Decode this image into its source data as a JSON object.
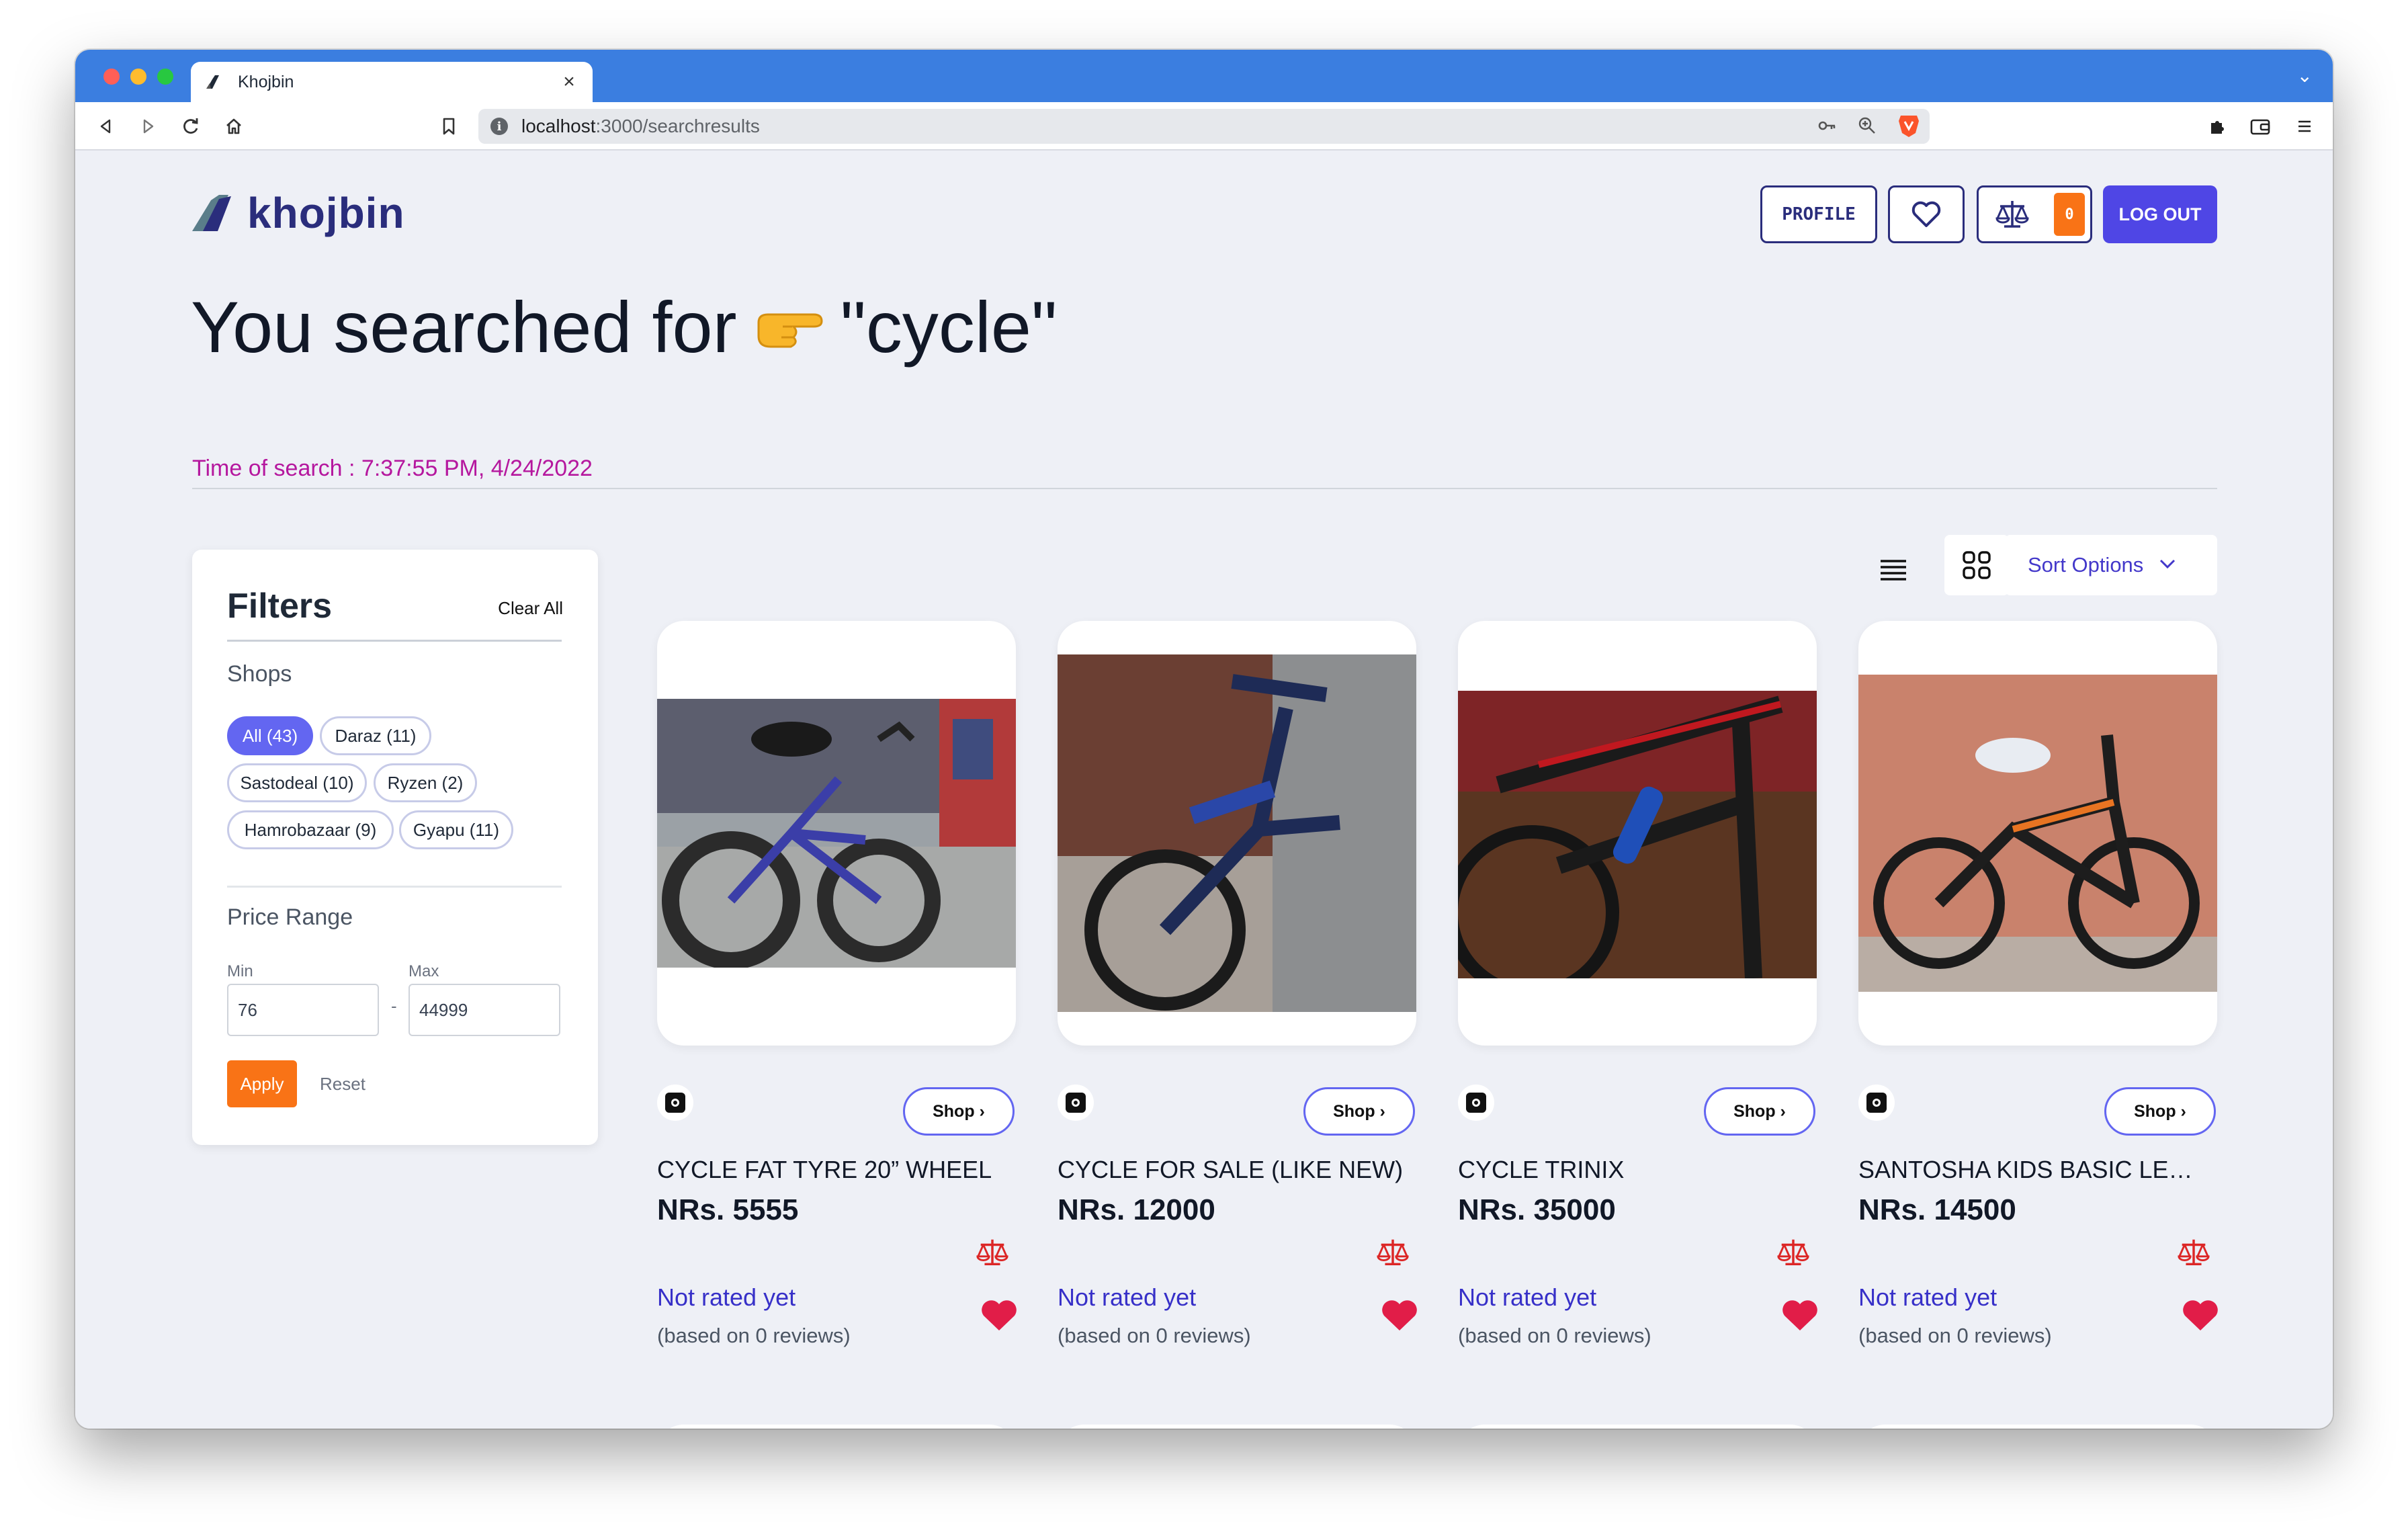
{
  "browser": {
    "tab_title": "Khojbin",
    "url_host": "localhost",
    "url_path": ":3000/searchresults"
  },
  "header": {
    "logo_text": "khojbin",
    "profile_label": "PROFILE",
    "compare_count": "0",
    "logout_label": "LOG OUT"
  },
  "search": {
    "prefix": "You searched for",
    "emoji": "👉",
    "query": "\"cycle\"",
    "time": "Time of search : 7:37:55 PM, 4/24/2022"
  },
  "filters": {
    "title": "Filters",
    "clear_all": "Clear All",
    "shops_label": "Shops",
    "shops": [
      {
        "label": "All (43)",
        "active": true
      },
      {
        "label": "Daraz (11)",
        "active": false
      },
      {
        "label": "Sastodeal (10)",
        "active": false
      },
      {
        "label": "Ryzen (2)",
        "active": false
      },
      {
        "label": "Hamrobazaar (9)",
        "active": false
      },
      {
        "label": "Gyapu (11)",
        "active": false
      }
    ],
    "price_label": "Price Range",
    "min_label": "Min",
    "max_label": "Max",
    "min_value": "76",
    "max_value": "44999",
    "dash": "-",
    "apply_label": "Apply",
    "reset_label": "Reset"
  },
  "sort": {
    "label": "Sort Options"
  },
  "products": [
    {
      "name": "CYCLE FAT TYRE 20” WHEEL",
      "price": "NRs. 5555",
      "shop_label": "Shop ›",
      "rating": "Not rated yet",
      "reviews": "(based on 0 reviews)"
    },
    {
      "name": "CYCLE FOR SALE (LIKE NEW)",
      "price": "NRs. 12000",
      "shop_label": "Shop ›",
      "rating": "Not rated yet",
      "reviews": "(based on 0 reviews)"
    },
    {
      "name": "CYCLE TRINIX",
      "price": "NRs. 35000",
      "shop_label": "Shop ›",
      "rating": "Not rated yet",
      "reviews": "(based on 0 reviews)"
    },
    {
      "name": "SANTOSHA KIDS BASIC LEVEL ...",
      "price": "NRs. 14500",
      "shop_label": "Shop ›",
      "rating": "Not rated yet",
      "reviews": "(based on 0 reviews)"
    }
  ],
  "colors": {
    "accent": "#4f46e5",
    "brand": "#2a2d7c",
    "orange": "#f97316",
    "time_text": "#b5179e",
    "heart": "#e11d48",
    "scale": "#dc2626"
  },
  "icons": [
    "info-icon",
    "back-icon",
    "forward-icon",
    "reload-icon",
    "home-icon",
    "bookmark-icon",
    "key-icon",
    "zoom-icon",
    "brave-icon",
    "extensions-icon",
    "wallet-icon",
    "menu-icon",
    "heart-icon",
    "scale-icon",
    "list-view-icon",
    "grid-view-icon",
    "chevron-down-icon"
  ]
}
